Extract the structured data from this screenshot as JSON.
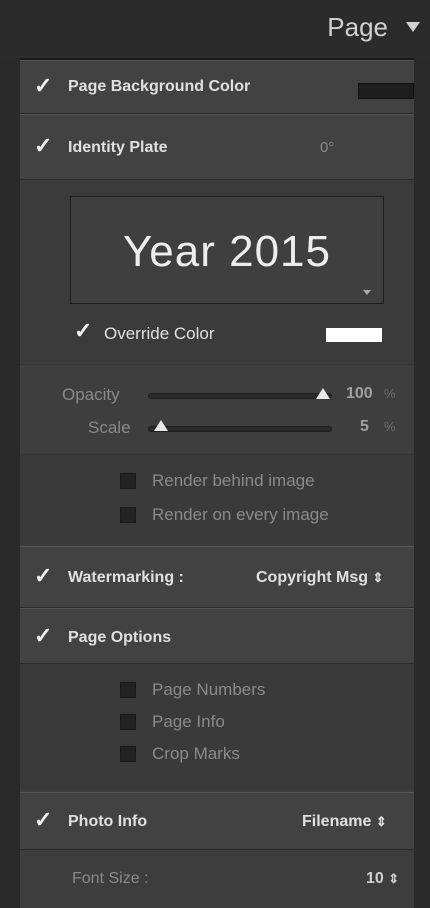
{
  "header": {
    "title": "Page"
  },
  "page_background": {
    "label": "Page Background Color",
    "checked": true,
    "color": "#1e1e1e"
  },
  "identity_plate": {
    "label": "Identity Plate",
    "checked": true,
    "rotation": "0°",
    "text": "Year 2015",
    "override_color": {
      "label": "Override Color",
      "checked": true,
      "color": "#ffffff"
    },
    "opacity": {
      "label": "Opacity",
      "value": "100",
      "unit": "%",
      "level": 1.0
    },
    "scale": {
      "label": "Scale",
      "value": "5",
      "unit": "%",
      "level": 0.05
    },
    "render_behind": {
      "label": "Render behind image",
      "checked": false
    },
    "render_every": {
      "label": "Render on every image",
      "checked": false
    }
  },
  "watermarking": {
    "label": "Watermarking :",
    "checked": true,
    "value": "Copyright Msg",
    "arrows": "⇕"
  },
  "page_options": {
    "label": "Page Options",
    "checked": true,
    "items": [
      {
        "label": "Page Numbers",
        "checked": false
      },
      {
        "label": "Page Info",
        "checked": false
      },
      {
        "label": "Crop Marks",
        "checked": false
      }
    ]
  },
  "photo_info": {
    "label": "Photo Info",
    "checked": true,
    "value": "Filename",
    "arrows": "⇕"
  },
  "font_size": {
    "label": "Font Size :",
    "value": "10",
    "arrows": "⇕"
  },
  "colors": {
    "panel": "#3d3d3d",
    "header": "#2b2b2b",
    "text": "#e0e0e0",
    "muted": "#8a8a8a"
  }
}
